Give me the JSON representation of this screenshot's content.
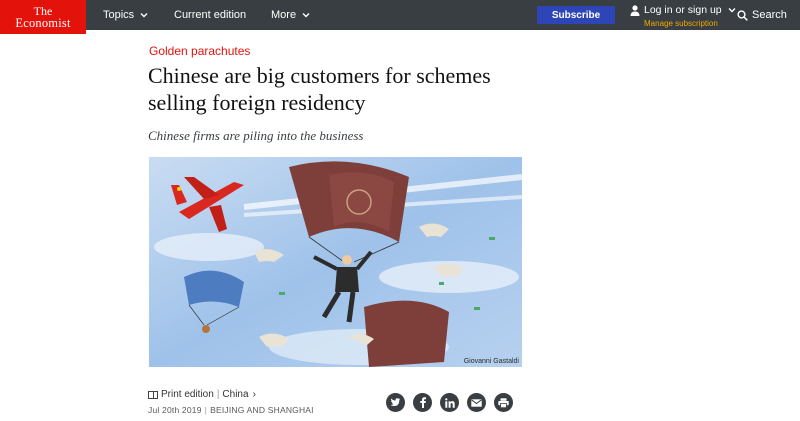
{
  "nav": {
    "logo_line1": "The",
    "logo_line2": "Economist",
    "topics": "Topics",
    "current_edition": "Current edition",
    "more": "More",
    "subscribe": "Subscribe",
    "login": "Log in or sign up",
    "manage": "Manage subscription",
    "search": "Search"
  },
  "article": {
    "rubric": "Golden parachutes",
    "headline_line1": "Chinese are big customers for schemes",
    "headline_line2": "selling foreign residency",
    "subheadline": "Chinese firms are piling into the business",
    "image_credit": "Giovanni Gastaldi",
    "section_meta": {
      "print_edition": "Print edition",
      "section": "China"
    },
    "dateline": {
      "date": "Jul 20th 2019",
      "location": "BEIJING AND SHANGHAI"
    }
  },
  "share_icons": [
    "twitter-icon",
    "facebook-icon",
    "linkedin-icon",
    "mail-icon",
    "print-icon"
  ],
  "colors": {
    "nav_bg": "#383e42",
    "brand_red": "#e3120b",
    "subscribe_blue": "#2e45b8",
    "manage_link": "#f2a900"
  }
}
